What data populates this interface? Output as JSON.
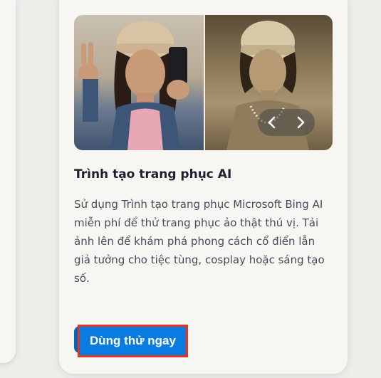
{
  "card": {
    "title": "Trình tạo trang phục AI",
    "description": "Sử dụng Trình tạo trang phục Microsoft Bing AI miễn phí để thử trang phục ảo thật thú vị. Tải ảnh lên để khám phá phong cách cổ điển lẫn giả tưởng cho tiệc tùng, cosplay hoặc sáng tạo số.",
    "cta_label": "Dùng thử ngay"
  },
  "carousel": {
    "prev_icon": "chevron-left-icon",
    "next_icon": "chevron-right-icon"
  },
  "colors": {
    "cta_background": "#0a7be0",
    "highlight_border": "#e8341c",
    "left_accent": "#e8457f"
  }
}
